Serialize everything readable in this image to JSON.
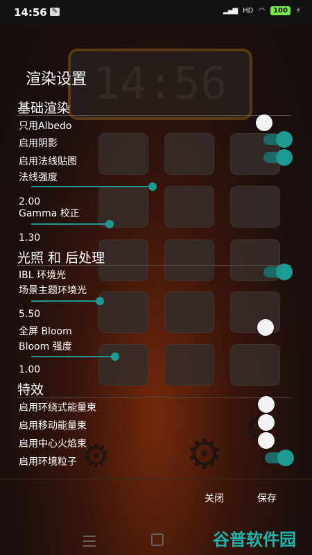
{
  "status_bar": {
    "time": "14:56",
    "network": "HD",
    "battery": "100"
  },
  "background": {
    "clock": "14:56"
  },
  "dialog": {
    "title": "渲染设置",
    "sections": {
      "basic": "基础渲染",
      "lighting": "光照 和 后处理",
      "effects": "特效"
    },
    "rows": {
      "albedo_only": {
        "label": "只用Albedo",
        "on": false
      },
      "shadows": {
        "label": "启用阴影",
        "on": true
      },
      "normal_map": {
        "label": "启用法线贴图",
        "on": true
      },
      "normal_strength": {
        "label": "法线强度",
        "value": "2.00",
        "fraction": 0.97
      },
      "gamma": {
        "label": "Gamma 校正",
        "value": "1.30",
        "fraction": 0.63
      },
      "ibl": {
        "label": "IBL 环境光",
        "on": true
      },
      "scene_ambient": {
        "label": "场景主题环境光",
        "value": "5.50",
        "fraction": 0.55
      },
      "bloom": {
        "label": "全屏 Bloom",
        "on": false
      },
      "bloom_strength": {
        "label": "Bloom 强度",
        "value": "1.00",
        "fraction": 0.67
      },
      "orbit_beam": {
        "label": "启用环绕式能量束",
        "on": false
      },
      "mobile_beam": {
        "label": "启用移动能量束",
        "on": false
      },
      "center_flame": {
        "label": "启用中心火焰束",
        "on": false
      },
      "ambient_particles": {
        "label": "启用环境粒子",
        "on": true
      }
    },
    "buttons": {
      "close": "关闭",
      "save": "保存"
    }
  },
  "watermark": "谷普软件园",
  "colors": {
    "accent": "#1f9a93",
    "toggle_track_on": "#1b6a66",
    "knob_off": "#f2f2f2"
  }
}
